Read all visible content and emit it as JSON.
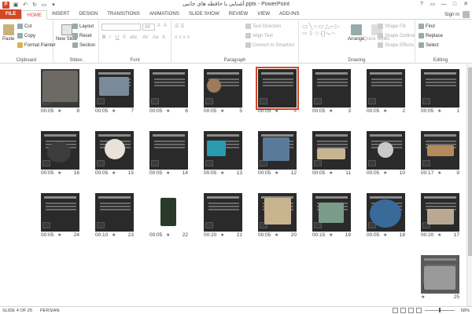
{
  "window": {
    "title": "آشنایی با حافظه های جانبی.pptx - PowerPoint",
    "app_letter": "P",
    "controls": [
      "?",
      "▭",
      "—",
      "□",
      "✕"
    ]
  },
  "tabs": [
    "FILE",
    "HOME",
    "INSERT",
    "DESIGN",
    "TRANSITIONS",
    "ANIMATIONS",
    "SLIDE SHOW",
    "REVIEW",
    "VIEW",
    "ADD-INS"
  ],
  "active_tab": "HOME",
  "signin": "Sign in",
  "ribbon": {
    "clipboard": {
      "label": "Clipboard",
      "paste": "Paste",
      "cut": "Cut",
      "copy": "Copy",
      "format_painter": "Format Painter"
    },
    "slides": {
      "label": "Slides",
      "new_slide": "New Slide",
      "layout": "Layout",
      "reset": "Reset",
      "section": "Section"
    },
    "font": {
      "label": "Font",
      "size": "44"
    },
    "paragraph": {
      "label": "Paragraph",
      "text_direction": "Text Direction",
      "align_text": "Align Text",
      "convert": "Convert to SmartArt"
    },
    "drawing": {
      "label": "Drawing",
      "arrange": "Arrange",
      "quick_styles": "Quick Styles",
      "shape_fill": "Shape Fill",
      "shape_outline": "Shape Outline",
      "shape_effects": "Shape Effects"
    },
    "editing": {
      "label": "Editing",
      "find": "Find",
      "replace": "Replace",
      "select": "Select"
    }
  },
  "slides": [
    {
      "num": "1",
      "time": "00:05"
    },
    {
      "num": "2",
      "time": "00:05"
    },
    {
      "num": "3",
      "time": "00:05"
    },
    {
      "num": "4",
      "time": "00:05"
    },
    {
      "num": "5",
      "time": "00:05"
    },
    {
      "num": "6",
      "time": "00:05"
    },
    {
      "num": "7",
      "time": "00:05"
    },
    {
      "num": "8",
      "time": "00:05"
    },
    {
      "num": "9",
      "time": "00:17"
    },
    {
      "num": "10",
      "time": "00:05"
    },
    {
      "num": "11",
      "time": "00:05"
    },
    {
      "num": "12",
      "time": "00:05"
    },
    {
      "num": "13",
      "time": "00:05"
    },
    {
      "num": "14",
      "time": "00:05"
    },
    {
      "num": "15",
      "time": "00:05"
    },
    {
      "num": "16",
      "time": "00:05"
    },
    {
      "num": "17",
      "time": "00:20"
    },
    {
      "num": "18",
      "time": "00:05"
    },
    {
      "num": "19",
      "time": "00:15"
    },
    {
      "num": "20",
      "time": "00:05"
    },
    {
      "num": "21",
      "time": "00:20"
    },
    {
      "num": "22",
      "time": "00:05"
    },
    {
      "num": "23",
      "time": "00:10"
    },
    {
      "num": "24",
      "time": "00:05"
    },
    {
      "num": "25",
      "time": ""
    }
  ],
  "selected_slide": "4",
  "status": {
    "slide_info": "SLIDE 4 OF 25",
    "language": "PERSIAN",
    "zoom": "58%"
  },
  "colors": {
    "accent": "#d24726"
  }
}
